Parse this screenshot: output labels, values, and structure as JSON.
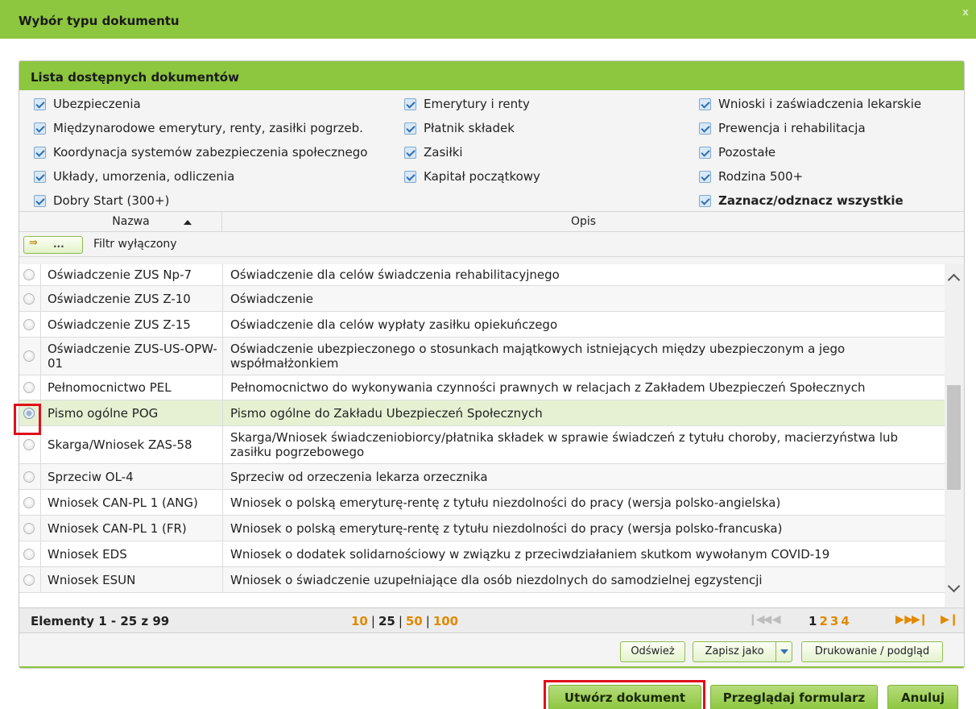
{
  "window": {
    "title": "Wybór typu dokumentu",
    "close_glyph": "x"
  },
  "panel": {
    "title": "Lista dostępnych dokumentów"
  },
  "filters": [
    {
      "label": "Ubezpieczenia",
      "checked": true
    },
    {
      "label": "Emerytury i renty",
      "checked": true
    },
    {
      "label": "Wnioski i zaświadczenia lekarskie",
      "checked": true
    },
    {
      "label": "Międzynarodowe emerytury, renty, zasiłki pogrzeb.",
      "checked": true
    },
    {
      "label": "Płatnik składek",
      "checked": true
    },
    {
      "label": "Prewencja i rehabilitacja",
      "checked": true
    },
    {
      "label": "Koordynacja systemów zabezpieczenia społecznego",
      "checked": true
    },
    {
      "label": "Zasiłki",
      "checked": true
    },
    {
      "label": "Pozostałe",
      "checked": true
    },
    {
      "label": "Układy, umorzenia, odliczenia",
      "checked": true
    },
    {
      "label": "Kapitał początkowy",
      "checked": true
    },
    {
      "label": "Rodzina 500+",
      "checked": true
    },
    {
      "label": "Dobry Start (300+)",
      "checked": true
    },
    {
      "label": "Zaznacz/odznacz wszystkie",
      "checked": true
    }
  ],
  "columns": {
    "name": "Nazwa",
    "desc": "Opis"
  },
  "filter_bar": {
    "button_dots": "...",
    "status": "Filtr wyłączony"
  },
  "rows": [
    {
      "name": "Oświadczenie ZUS Np-7",
      "desc": "Oświadczenie dla celów świadczenia rehabilitacyjnego"
    },
    {
      "name": "Oświadczenie ZUS Z-10",
      "desc": "Oświadczenie"
    },
    {
      "name": "Oświadczenie ZUS Z-15",
      "desc": "Oświadczenie dla celów wypłaty zasiłku opiekuńczego"
    },
    {
      "name": "Oświadczenie ZUS-US-OPW-01",
      "desc": "Oświadczenie ubezpieczonego o stosunkach majątkowych istniejących między ubezpieczonym a jego współmałżonkiem"
    },
    {
      "name": "Pełnomocnictwo PEL",
      "desc": "Pełnomocnictwo do wykonywania czynności prawnych w relacjach z Zakładem Ubezpieczeń Społecznych"
    },
    {
      "name": "Pismo ogólne POG",
      "desc": "Pismo ogólne do Zakładu Ubezpieczeń Społecznych",
      "selected": true
    },
    {
      "name": "Skarga/Wniosek ZAS-58",
      "desc": "Skarga/Wniosek świadczeniobiorcy/płatnika składek w sprawie świadczeń z tytułu choroby, macierzyństwa lub zasiłku pogrzebowego"
    },
    {
      "name": "Sprzeciw OL-4",
      "desc": "Sprzeciw od orzeczenia lekarza orzecznika"
    },
    {
      "name": "Wniosek CAN-PL 1 (ANG)",
      "desc": "Wniosek o polską emeryturę-rentę z tytułu niezdolności do pracy (wersja polsko-angielska)"
    },
    {
      "name": "Wniosek CAN-PL 1 (FR)",
      "desc": "Wniosek o polską emeryturę-rentę z tytułu niezdolności do pracy (wersja polsko-francuska)"
    },
    {
      "name": "Wniosek EDS",
      "desc": "Wniosek o dodatek solidarnościowy w związku z przeciwdziałaniem skutkom wywołanym COVID-19"
    },
    {
      "name": "Wniosek ESUN",
      "desc": "Wniosek o świadczenie uzupełniające dla osób niezdolnych do samodzielnej egzystencji"
    }
  ],
  "pager": {
    "count_text": "Elementy 1 - 25 z 99",
    "sizes": [
      "10",
      "25",
      "50",
      "100"
    ],
    "current_size": "25",
    "pages": [
      "1",
      "2",
      "3",
      "4"
    ],
    "current_page": "1"
  },
  "toolbar": {
    "refresh": "Odśwież",
    "save_as": "Zapisz jako",
    "print": "Drukowanie / podgląd"
  },
  "footer": {
    "create": "Utwórz dokument",
    "browse": "Przeglądaj formularz",
    "cancel": "Anuluj"
  },
  "colors": {
    "accent_green": "#8dc63f",
    "highlight_red": "#e0101a",
    "pager_orange": "#e08a00",
    "selected_row": "#e6f1d4"
  }
}
